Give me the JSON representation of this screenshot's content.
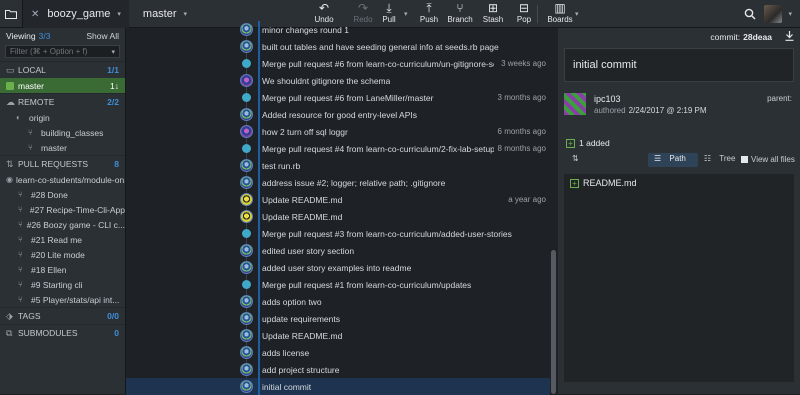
{
  "toolbar": {
    "repo_name": "boozy_game",
    "branch_name": "master",
    "buttons": [
      {
        "label": "Undo",
        "icon": "undo-icon",
        "disabled": false
      },
      {
        "label": "Redo",
        "icon": "redo-icon",
        "disabled": true
      },
      {
        "label": "Pull",
        "icon": "pull-icon",
        "disabled": false
      },
      {
        "label": "Push",
        "icon": "push-icon",
        "disabled": false
      },
      {
        "label": "Branch",
        "icon": "branch-icon",
        "disabled": false
      },
      {
        "label": "Stash",
        "icon": "stash-icon",
        "disabled": false
      },
      {
        "label": "Pop",
        "icon": "pop-icon",
        "disabled": false
      },
      {
        "label": "Boards",
        "icon": "boards-icon",
        "disabled": false
      }
    ]
  },
  "sidebar": {
    "viewing_label": "Viewing",
    "viewing_count": "3/3",
    "show_all": "Show All",
    "filter_placeholder": "Filter (⌘ + Option + f)",
    "local": {
      "label": "LOCAL",
      "count": "1/1"
    },
    "local_branches": [
      {
        "name": "master",
        "badge": "1↓"
      }
    ],
    "remote": {
      "label": "REMOTE",
      "count": "2/2"
    },
    "remote_items": [
      {
        "name": "origin",
        "level": 1
      },
      {
        "name": "building_classes",
        "level": 2
      },
      {
        "name": "master",
        "level": 2
      }
    ],
    "pull_requests": {
      "label": "PULL REQUESTS",
      "count": "8"
    },
    "pr_repo": "learn-co-students/module-on...",
    "pr_items": [
      "#28 Done",
      "#27 Recipe-Time-Cli-App",
      "#26 Boozy game - CLI c...",
      "#21 Read me",
      "#20 Lite mode",
      "#18 Ellen",
      "#9 Starting cli",
      "#5 Player/stats/api int..."
    ],
    "tags": {
      "label": "TAGS",
      "count": "0/0"
    },
    "submodules": {
      "label": "SUBMODULES",
      "count": "0"
    }
  },
  "commits": [
    {
      "message": "minor changes round 1",
      "time": "",
      "avatar": "avatar",
      "partial": true
    },
    {
      "message": "built out tables and have seeding general info at seeds.rb page",
      "time": "",
      "avatar": "avatar"
    },
    {
      "message": "Merge pull request #6 from learn-co-curriculum/un-gitignore-sche...",
      "time": "3 weeks ago",
      "avatar": "dot"
    },
    {
      "message": "We shouldnt gitignore the schema",
      "time": "",
      "avatar": "pink"
    },
    {
      "message": "Merge pull request #6 from LaneMiller/master",
      "time": "3 months ago",
      "avatar": "dot"
    },
    {
      "message": "Added resource for good entry-level APIs",
      "time": "",
      "avatar": "avatar"
    },
    {
      "message": "how 2 turn off sql loggr",
      "time": "6 months ago",
      "avatar": "pink"
    },
    {
      "message": "Merge pull request #4 from learn-co-curriculum/2-fix-lab-setup",
      "time": "8 months ago",
      "avatar": "dot"
    },
    {
      "message": "test run.rb",
      "time": "",
      "avatar": "avatar"
    },
    {
      "message": "address issue #2; logger; relative path; .gitignore",
      "time": "",
      "avatar": "avatar"
    },
    {
      "message": "Update README.md",
      "time": "a year ago",
      "avatar": "yellow"
    },
    {
      "message": "Update README.md",
      "time": "",
      "avatar": "yellow"
    },
    {
      "message": "Merge pull request #3 from learn-co-curriculum/added-user-stories",
      "time": "",
      "avatar": "dot"
    },
    {
      "message": "edited user story section",
      "time": "",
      "avatar": "avatar"
    },
    {
      "message": "added user story examples into readme",
      "time": "",
      "avatar": "avatar"
    },
    {
      "message": "Merge pull request #1 from learn-co-curriculum/updates",
      "time": "",
      "avatar": "dot"
    },
    {
      "message": "adds option two",
      "time": "",
      "avatar": "avatar"
    },
    {
      "message": "update requirements",
      "time": "",
      "avatar": "avatar"
    },
    {
      "message": "Update README.md",
      "time": "",
      "avatar": "avatar"
    },
    {
      "message": "adds license",
      "time": "",
      "avatar": "avatar"
    },
    {
      "message": "add project structure",
      "time": "",
      "avatar": "avatar"
    },
    {
      "message": "initial commit",
      "time": "",
      "avatar": "avatar",
      "selected": true
    }
  ],
  "detail": {
    "commit_label": "commit:",
    "commit_sha": "28deaa",
    "message": "initial commit",
    "author": "ipc103",
    "authored_label": "authored",
    "authored_date": "2/24/2017 @ 2:19 PM",
    "parent_label": "parent:",
    "added_label": "1 added",
    "path_label": "Path",
    "tree_label": "Tree",
    "view_all_label": "View all files",
    "files": [
      {
        "name": "README.md",
        "status": "added"
      }
    ]
  }
}
